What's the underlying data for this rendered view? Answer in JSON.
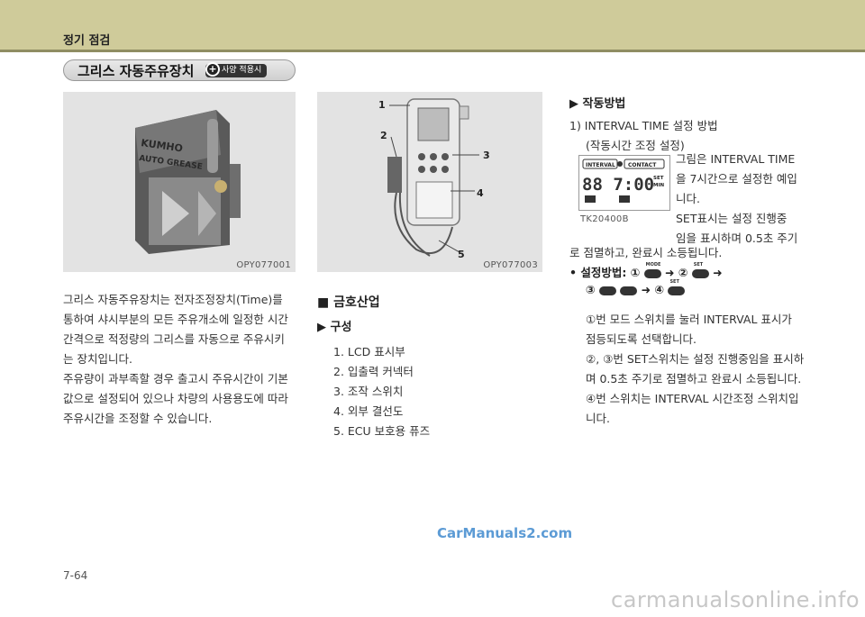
{
  "header": {
    "title": "정기 점검"
  },
  "section": {
    "title": "그리스 자동주유장치",
    "badge": "사양 적용시"
  },
  "figures": {
    "left": {
      "label": "OPY077001",
      "brand_top": "KUMHO",
      "brand_bottom": "AUTO GREASE"
    },
    "middle": {
      "label": "OPY077003",
      "callouts": [
        "1",
        "2",
        "3",
        "4",
        "5"
      ]
    },
    "display": {
      "label": "TK20400B",
      "btn_interval": "INTERVAL",
      "btn_contact": "CONTACT",
      "digits": "88 7:00",
      "set": "SET",
      "min": "MIN"
    }
  },
  "left_text": {
    "lines": [
      "그리스 자동주유장치는 전자조정장치(Time)를",
      "통하여 샤시부분의 모든 주유개소에 일정한 시간",
      "간격으로 적정량의 그리스를 자동으로 주유시키",
      "는 장치입니다.",
      "주유량이 과부족할 경우 출고시 주유시간이 기본",
      "값으로 설정되어 있으나 차량의 사용용도에 따라",
      "주유시간을 조정할 수 있습니다."
    ]
  },
  "middle_text": {
    "maker": "■ 금호산업",
    "composition": "▶ 구성",
    "items": [
      "1.  LCD 표시부",
      "2.  입출력 커넥터",
      "3.  조작 스위치",
      "4.  외부 결선도",
      "5.  ECU 보호용 퓨즈"
    ]
  },
  "right_text": {
    "heading": "▶ 작동방법",
    "step1": "1)  INTERVAL TIME 설정 방법",
    "step1_sub": "(작동시간 조정 설정)",
    "desc_lines": [
      "그림은 INTERVAL TIME",
      "을 7시간으로 설정한 예입",
      "니다.",
      "SET표시는 설정 진행중",
      "임을 표시하며 0.5초 주기"
    ],
    "desc_tail": "로 점멸하고, 완료시 소등됩니다.",
    "method_label": "•  설정방법: ①",
    "method_mid": "➜ ②",
    "method_end": "➜",
    "method_line2_a": "③",
    "method_line2_b": "➜ ④",
    "btn_mode": "MODE",
    "btn_set": "SET",
    "notes": [
      "①번 모드 스위치를 눌러 INTERVAL 표시가",
      "점등되도록 선택합니다.",
      "②, ③번 SET스위치는 설정 진행중임을 표시하",
      "며 0.5초 주기로 점멸하고 완료시 소등됩니다.",
      "④번 스위치는 INTERVAL 시간조정 스위치입",
      "니다."
    ]
  },
  "footer": {
    "page": "7-64",
    "watermark": "CarManuals2.com",
    "corner_watermark": "carmanualsonline.info"
  }
}
